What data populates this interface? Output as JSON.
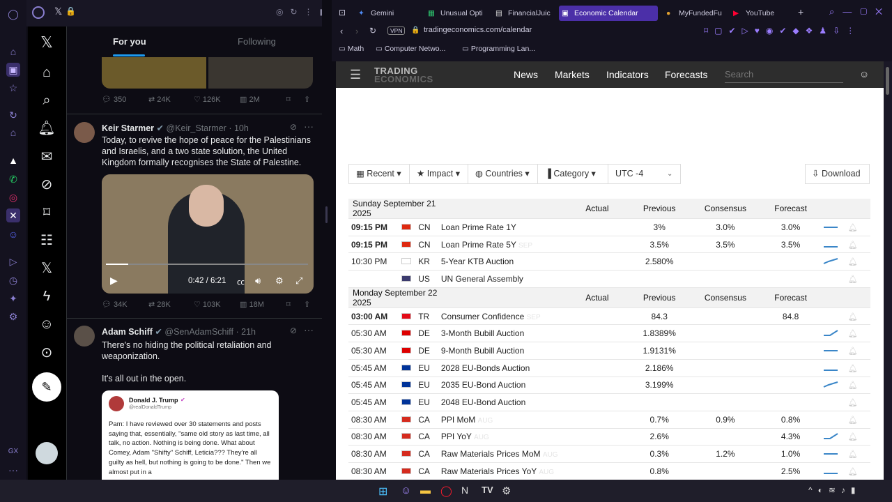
{
  "x": {
    "tabs": [
      "For you",
      "Following"
    ],
    "post1_stats": [
      "350",
      "24K",
      "126K",
      "2M"
    ],
    "tweet2": {
      "name": "Keir Starmer",
      "handle": "@Keir_Starmer",
      "age": "· 10h",
      "text": "Today, to revive the hope of peace for the Palestinians and Israelis, and a two state solution, the United Kingdom formally recognises the State of Palestine.",
      "video_time": "0:42 / 6:21",
      "stats": [
        "34K",
        "28K",
        "103K",
        "18M"
      ]
    },
    "tweet3": {
      "name": "Adam Schiff",
      "handle": "@SenAdamSchiff",
      "age": "· 21h",
      "text1": "There's no hiding the political retaliation and weaponization.",
      "text2": "It's all out in the open.",
      "quote_name": "Donald J. Trump",
      "quote_handle": "@realDonaldTrump",
      "quote_text": "Pam: I have reviewed over 30 statements and posts saying that, essentially, \"same old story as last time, all talk, no action. Nothing is being done. What about Comey, Adam \"Shifty\" Schiff, Leticia??? They're all guilty as hell, but nothing is going to be done.\" Then we almost put in a"
    }
  },
  "browser": {
    "tabs": [
      "Gemini",
      "Unusual Opti",
      "FinancialJuic",
      "Economic Calendar",
      "MyFundedFu",
      "YouTube"
    ],
    "url": "tradingeconomics.com/calendar",
    "vpn": "VPN",
    "bookmarks": [
      "Math",
      "Computer Netwo...",
      "Programming Lan..."
    ]
  },
  "te": {
    "logo1": "TRADING",
    "logo2": "ECONOMICS",
    "nav": [
      "News",
      "Markets",
      "Indicators",
      "Forecasts"
    ],
    "search_placeholder": "Search",
    "filters": [
      "Recent",
      "Impact",
      "Countries",
      "Category",
      "UTC -4"
    ],
    "download": "Download",
    "headers": [
      "Actual",
      "Previous",
      "Consensus",
      "Forecast"
    ],
    "days": [
      {
        "date": "Sunday September 21 2025",
        "rows": [
          {
            "time": "09:15 PM",
            "bold": true,
            "flag": "#de2910",
            "cc": "CN",
            "event": "Loan Prime Rate 1Y",
            "ref": "",
            "actual": "",
            "previous": "3%",
            "consensus": "3.0%",
            "forecast": "3.0%"
          },
          {
            "time": "09:15 PM",
            "bold": true,
            "flag": "#de2910",
            "cc": "CN",
            "event": "Loan Prime Rate 5Y",
            "ref": "SEP",
            "actual": "",
            "previous": "3.5%",
            "consensus": "3.5%",
            "forecast": "3.5%"
          },
          {
            "time": "10:30 PM",
            "bold": false,
            "flag": "#ffffff",
            "cc": "KR",
            "event": "5-Year KTB Auction",
            "ref": "",
            "actual": "",
            "previous": "2.580%",
            "consensus": "",
            "forecast": ""
          },
          {
            "time": "",
            "bold": false,
            "flag": "#3c3b6e",
            "cc": "US",
            "event": "UN General Assembly",
            "ref": "",
            "actual": "",
            "previous": "",
            "consensus": "",
            "forecast": ""
          }
        ]
      },
      {
        "date": "Monday September 22 2025",
        "rows": [
          {
            "time": "03:00 AM",
            "bold": true,
            "flag": "#e30a17",
            "cc": "TR",
            "event": "Consumer Confidence",
            "ref": "SEP",
            "actual": "",
            "previous": "84.3",
            "consensus": "",
            "forecast": "84.8"
          },
          {
            "time": "05:30 AM",
            "bold": false,
            "flag": "#dd0000",
            "cc": "DE",
            "event": "3-Month Bubill Auction",
            "ref": "",
            "actual": "",
            "previous": "1.8389%",
            "consensus": "",
            "forecast": ""
          },
          {
            "time": "05:30 AM",
            "bold": false,
            "flag": "#dd0000",
            "cc": "DE",
            "event": "9-Month Bubill Auction",
            "ref": "",
            "actual": "",
            "previous": "1.9131%",
            "consensus": "",
            "forecast": ""
          },
          {
            "time": "05:45 AM",
            "bold": false,
            "flag": "#003399",
            "cc": "EU",
            "event": "2028 EU-Bonds Auction",
            "ref": "",
            "actual": "",
            "previous": "2.186%",
            "consensus": "",
            "forecast": ""
          },
          {
            "time": "05:45 AM",
            "bold": false,
            "flag": "#003399",
            "cc": "EU",
            "event": "2035 EU-Bond Auction",
            "ref": "",
            "actual": "",
            "previous": "3.199%",
            "consensus": "",
            "forecast": ""
          },
          {
            "time": "05:45 AM",
            "bold": false,
            "flag": "#003399",
            "cc": "EU",
            "event": "2048 EU-Bond Auction",
            "ref": "",
            "actual": "",
            "previous": "",
            "consensus": "",
            "forecast": ""
          },
          {
            "time": "08:30 AM",
            "bold": false,
            "flag": "#d52b1e",
            "cc": "CA",
            "event": "PPI MoM",
            "ref": "AUG",
            "actual": "",
            "previous": "0.7%",
            "consensus": "0.9%",
            "forecast": "0.8%"
          },
          {
            "time": "08:30 AM",
            "bold": false,
            "flag": "#d52b1e",
            "cc": "CA",
            "event": "PPI YoY",
            "ref": "AUG",
            "actual": "",
            "previous": "2.6%",
            "consensus": "",
            "forecast": "4.3%"
          },
          {
            "time": "08:30 AM",
            "bold": false,
            "flag": "#d52b1e",
            "cc": "CA",
            "event": "Raw Materials Prices MoM",
            "ref": "AUG",
            "actual": "",
            "previous": "0.3%",
            "consensus": "1.2%",
            "forecast": "1.0%"
          },
          {
            "time": "08:30 AM",
            "bold": false,
            "flag": "#d52b1e",
            "cc": "CA",
            "event": "Raw Materials Prices YoY",
            "ref": "AUG",
            "actual": "",
            "previous": "0.8%",
            "consensus": "",
            "forecast": "2.5%"
          }
        ]
      }
    ]
  },
  "colors": {
    "accent": "#4b2fa8",
    "te_green": "#1a7f1a",
    "spark_blue": "#3a86c8"
  }
}
